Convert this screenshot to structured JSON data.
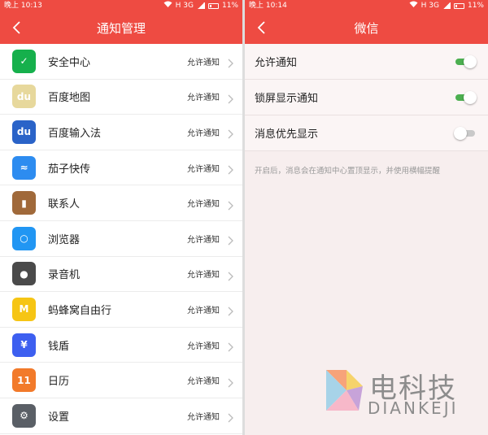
{
  "left": {
    "status_time": "晚上 10:13",
    "status_network": "H 3G",
    "status_battery": "11%",
    "title": "通知管理",
    "apps": [
      {
        "name": "安全中心",
        "status": "允许通知",
        "color": "#16b04c",
        "glyph": "✓"
      },
      {
        "name": "百度地图",
        "status": "允许通知",
        "color": "#e7d89c",
        "glyph": "du"
      },
      {
        "name": "百度输入法",
        "status": "允许通知",
        "color": "#2a63c8",
        "glyph": "du"
      },
      {
        "name": "茄子快传",
        "status": "允许通知",
        "color": "#2d8cf0",
        "glyph": "≈"
      },
      {
        "name": "联系人",
        "status": "允许通知",
        "color": "#a0693a",
        "glyph": "▮"
      },
      {
        "name": "浏览器",
        "status": "允许通知",
        "color": "#2196f3",
        "glyph": "○"
      },
      {
        "name": "录音机",
        "status": "允许通知",
        "color": "#4a4a4a",
        "glyph": "●"
      },
      {
        "name": "蚂蜂窝自由行",
        "status": "允许通知",
        "color": "#f6c514",
        "glyph": "M"
      },
      {
        "name": "钱盾",
        "status": "允许通知",
        "color": "#3d5ff0",
        "glyph": "¥"
      },
      {
        "name": "日历",
        "status": "允许通知",
        "color": "#f27a2a",
        "glyph": "11"
      },
      {
        "name": "设置",
        "status": "允许通知",
        "color": "#5a5f66",
        "glyph": "⚙"
      }
    ]
  },
  "right": {
    "status_time": "晚上 10:14",
    "status_network": "H 3G",
    "status_battery": "11%",
    "title": "微信",
    "settings": [
      {
        "label": "允许通知",
        "on": true
      },
      {
        "label": "锁屏显示通知",
        "on": true
      },
      {
        "label": "消息优先显示",
        "on": false
      }
    ],
    "hint": "开启后，消息会在通知中心置顶显示，并使用横幅提醒"
  },
  "watermark": {
    "cn": "电科技",
    "en": "DIANKEJI"
  },
  "colors": {
    "accent": "#ee4b42",
    "toggle_on": "#4caf50",
    "toggle_off": "#c9c9c9"
  }
}
